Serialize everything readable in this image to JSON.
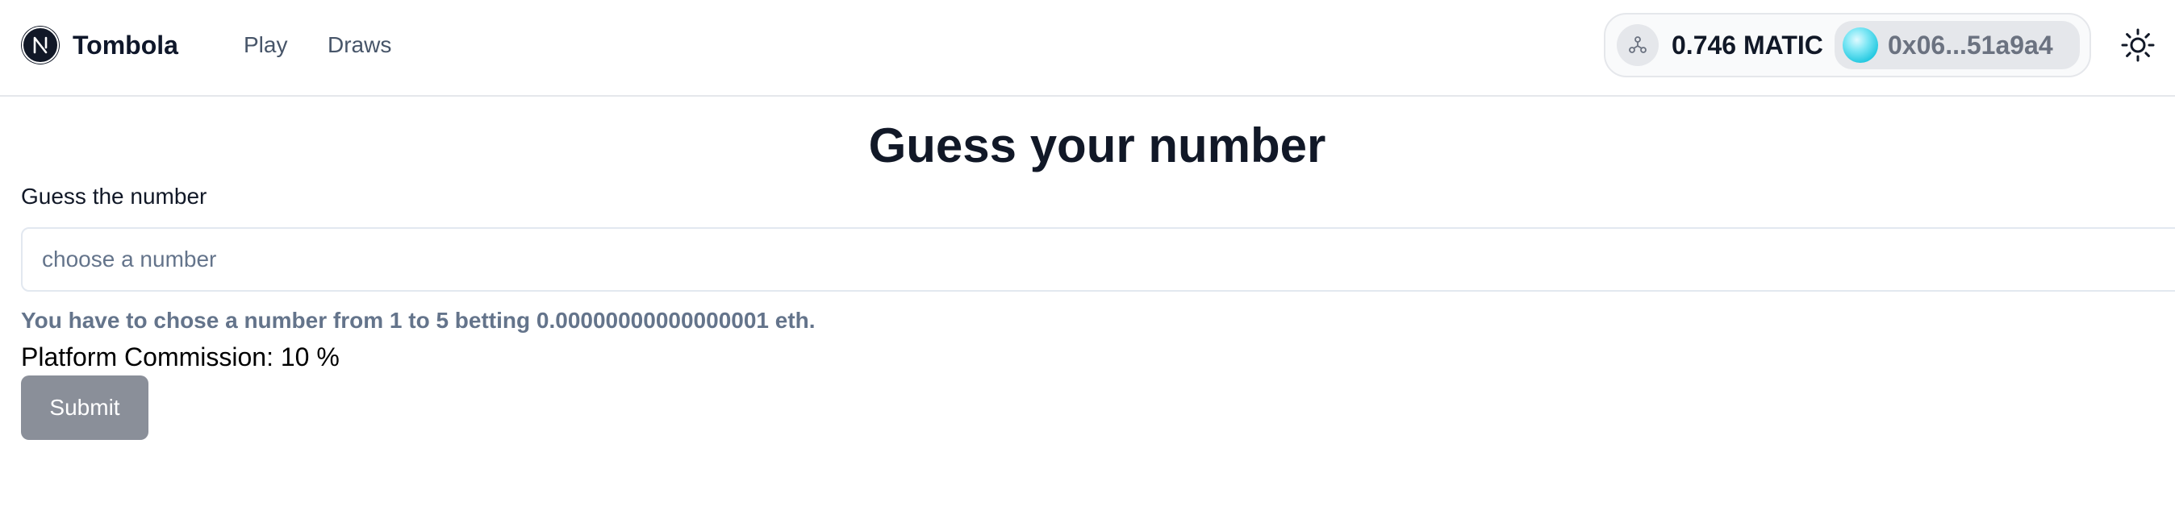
{
  "header": {
    "brand": "Tombola",
    "nav": [
      {
        "label": "Play"
      },
      {
        "label": "Draws"
      }
    ]
  },
  "wallet": {
    "balance": "0.746 MATIC",
    "address": "0x06...51a9a4",
    "icons": {
      "chain": "polygon-network-icon",
      "theme": "sun-icon"
    }
  },
  "main": {
    "title": "Guess your number",
    "field_label": "Guess the number",
    "input_placeholder": "choose a number",
    "input_value": "",
    "help_text": "You have to chose a number from 1 to 5 betting 0.00000000000000001 eth.",
    "commission": "Platform Commission: 10 %",
    "submit_label": "Submit"
  },
  "colors": {
    "submit_background": "#8a8f99",
    "help_text": "#64748b",
    "avatar_accent": "#22c8e0"
  }
}
